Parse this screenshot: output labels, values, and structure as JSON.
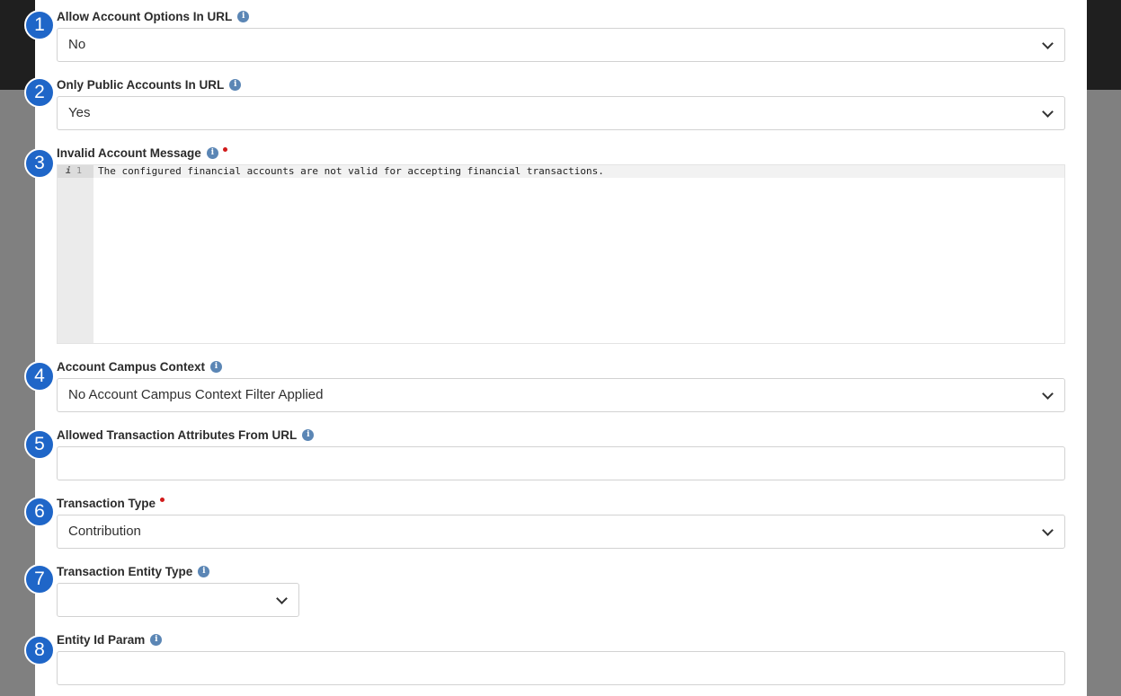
{
  "fields": [
    {
      "number": "1",
      "label": "Allow Account Options In URL",
      "value": "No"
    },
    {
      "number": "2",
      "label": "Only Public Accounts In URL",
      "value": "Yes"
    },
    {
      "number": "3",
      "label": "Invalid Account Message",
      "line_number": "1",
      "line_marker": "i",
      "code": "The configured financial accounts are not valid for accepting financial transactions."
    },
    {
      "number": "4",
      "label": "Account Campus Context",
      "value": "No Account Campus Context Filter Applied"
    },
    {
      "number": "5",
      "label": "Allowed Transaction Attributes From URL",
      "value": ""
    },
    {
      "number": "6",
      "label": "Transaction Type",
      "value": "Contribution"
    },
    {
      "number": "7",
      "label": "Transaction Entity Type",
      "value": ""
    },
    {
      "number": "8",
      "label": "Entity Id Param",
      "value": ""
    }
  ],
  "info_glyph": "i",
  "colors": {
    "badge": "#1f66c8",
    "info": "#5b86b5",
    "required": "#d11a1a"
  }
}
